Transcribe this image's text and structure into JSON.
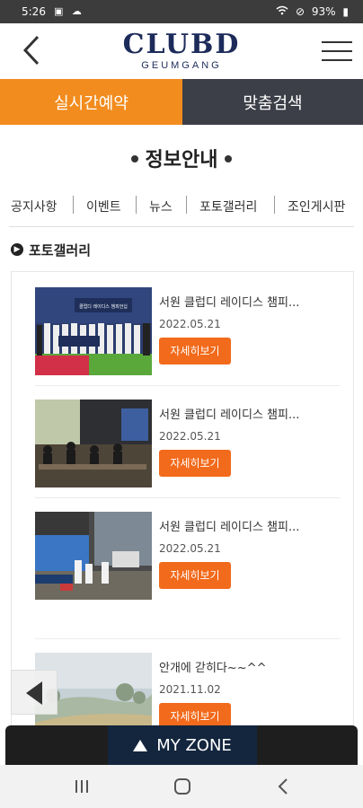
{
  "status_bar": {
    "time": "5:26",
    "left_icons": "▣ ☁",
    "wifi_icon": "wifi-icon",
    "dnd_icon": "⊘",
    "battery_pct": "93%",
    "battery_icon": "▮"
  },
  "header": {
    "logo_main": "CLUBD",
    "logo_sub": "GEUMGANG",
    "back_icon": "chevron-left-icon",
    "menu_icon": "hamburger-menu-icon"
  },
  "top_tabs": {
    "reserve": "실시간예약",
    "search": "맞춤검색",
    "reserve_color": "#f28c1e",
    "search_color": "#3d3f48"
  },
  "section": {
    "title": "정보안내"
  },
  "sub_nav": {
    "items": [
      "공지사항",
      "이벤트",
      "뉴스",
      "포토갤러리",
      "조인게시판"
    ]
  },
  "breadcrumb": {
    "label": "포토갤러리"
  },
  "gallery": {
    "items": [
      {
        "title": "서원 클럽디 레이디스 챔피...",
        "date": "2022.05.21",
        "button": "자세히보기",
        "banner_text": "클럽디 레이디스 챔피언십"
      },
      {
        "title": "서원 클럽디 레이디스 챔피...",
        "date": "2022.05.21",
        "button": "자세히보기"
      },
      {
        "title": "서원 클럽디 레이디스 챔피...",
        "date": "2022.05.21",
        "button": "자세히보기"
      },
      {
        "title": "안개에 갇히다~~^^",
        "date": "2021.11.02",
        "button": "자세히보기"
      }
    ]
  },
  "my_zone": {
    "label": "MY ZONE"
  },
  "android_nav": {
    "recents_icon": "recents-icon",
    "home_icon": "home-icon",
    "back_icon": "back-icon"
  },
  "colors": {
    "accent_orange": "#f26a1b",
    "brand_navy": "#1d2b5a"
  }
}
